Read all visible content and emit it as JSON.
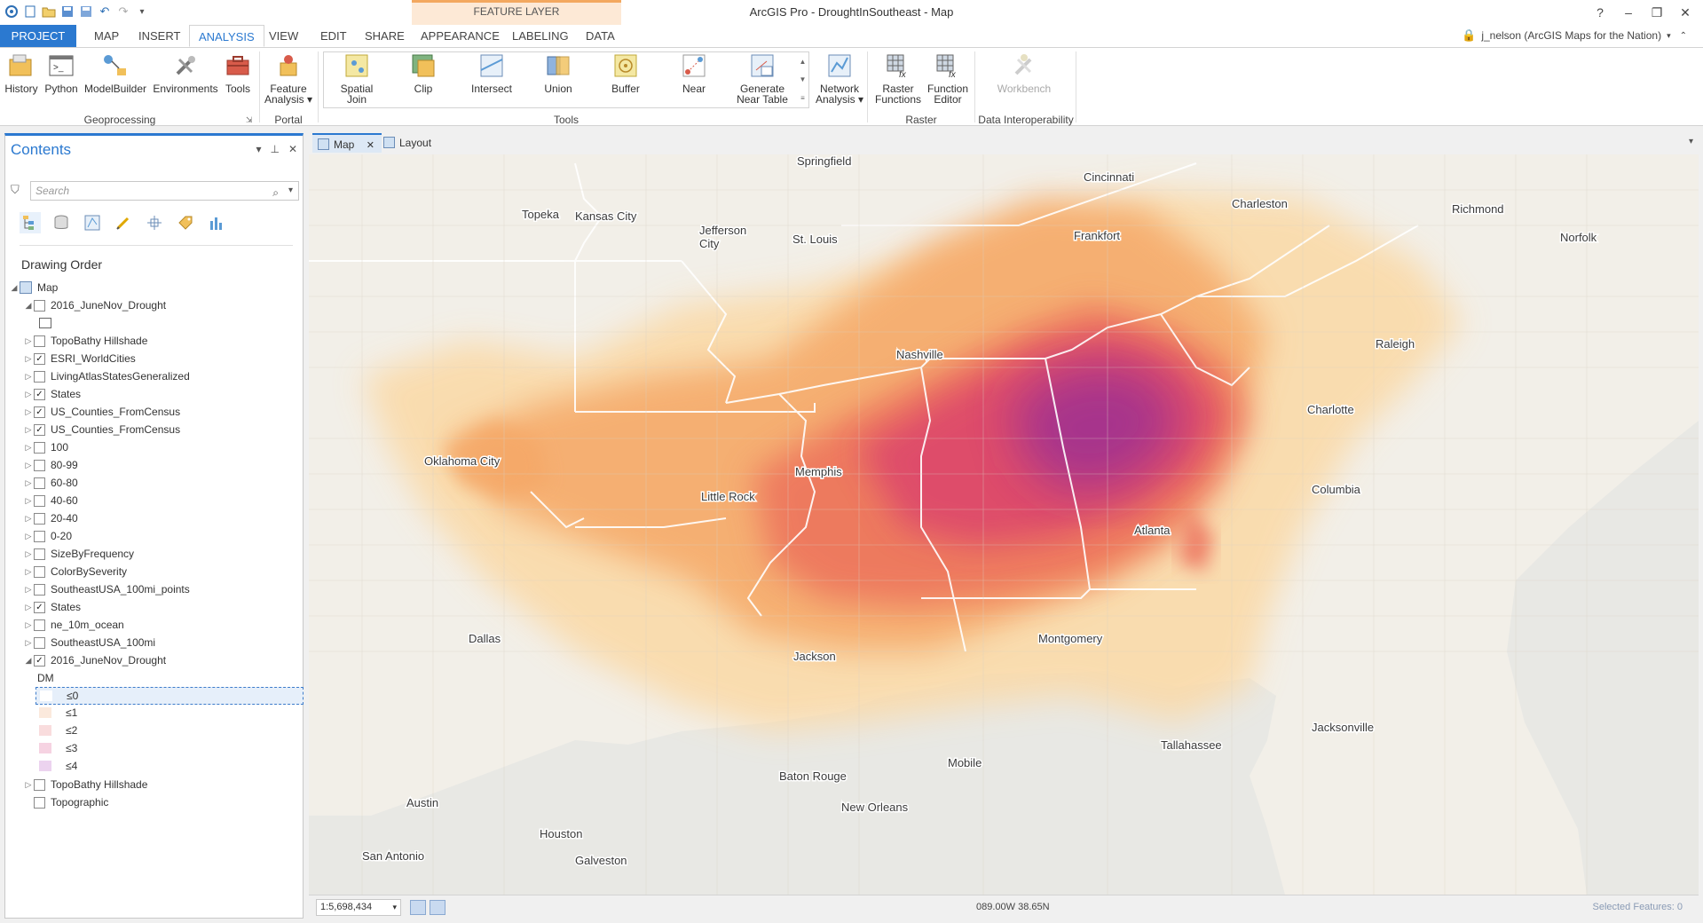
{
  "window": {
    "title": "ArcGIS Pro - DroughtInSoutheast - Map",
    "contextual_tab": "FEATURE LAYER",
    "help": "?",
    "minimize": "–",
    "restore": "❐",
    "close": "✕"
  },
  "ribbon_tabs": [
    "PROJECT",
    "MAP",
    "INSERT",
    "ANALYSIS",
    "VIEW",
    "EDIT",
    "SHARE",
    "APPEARANCE",
    "LABELING",
    "DATA"
  ],
  "user": "j_nelson (ArcGIS Maps for the Nation)",
  "ribbon": {
    "geoprocessing": {
      "label": "Geoprocessing",
      "buttons": [
        "History",
        "Python",
        "ModelBuilder",
        "Environments",
        "Tools"
      ]
    },
    "portal": {
      "label": "Portal",
      "feature_analysis": [
        "Feature",
        "Analysis"
      ]
    },
    "tools": {
      "label": "Tools",
      "spatial_join": [
        "Spatial",
        "Join"
      ],
      "clip": "Clip",
      "intersect": "Intersect",
      "union": "Union",
      "buffer": "Buffer",
      "near": "Near",
      "generate_near_table": [
        "Generate",
        "Near Table"
      ]
    },
    "network_analysis": [
      "Network",
      "Analysis"
    ],
    "raster": {
      "label": "Raster",
      "raster_functions": [
        "Raster",
        "Functions"
      ],
      "function_editor": [
        "Function",
        "Editor"
      ]
    },
    "data_interop": {
      "label": "Data Interoperability",
      "workbench": "Workbench"
    }
  },
  "contents": {
    "title": "Contents",
    "search_placeholder": "Search",
    "drawing_order": "Drawing Order",
    "map_name": "Map",
    "layers": [
      {
        "name": "2016_JuneNov_Drought",
        "checked": false,
        "expanded": true
      },
      {
        "name": "TopoBathy Hillshade",
        "checked": false
      },
      {
        "name": "ESRI_WorldCities",
        "checked": true
      },
      {
        "name": "LivingAtlasStatesGeneralized",
        "checked": false
      },
      {
        "name": "States",
        "checked": true
      },
      {
        "name": "US_Counties_FromCensus",
        "checked": true
      },
      {
        "name": "US_Counties_FromCensus",
        "checked": true
      },
      {
        "name": "100",
        "checked": false
      },
      {
        "name": "80-99",
        "checked": false
      },
      {
        "name": "60-80",
        "checked": false
      },
      {
        "name": "40-60",
        "checked": false
      },
      {
        "name": "20-40",
        "checked": false
      },
      {
        "name": "0-20",
        "checked": false
      },
      {
        "name": "SizeByFrequency",
        "checked": false
      },
      {
        "name": "ColorBySeverity",
        "checked": false
      },
      {
        "name": "SoutheastUSA_100mi_points",
        "checked": false
      },
      {
        "name": "States",
        "checked": true
      },
      {
        "name": "ne_10m_ocean",
        "checked": false
      },
      {
        "name": "SoutheastUSA_100mi",
        "checked": false
      },
      {
        "name": "2016_JuneNov_Drought",
        "checked": true,
        "expanded": true
      }
    ],
    "legend_field": "DM",
    "legend": [
      {
        "label": "≤0",
        "color": "#ffffff"
      },
      {
        "label": "≤1",
        "color": "#fbe9dc"
      },
      {
        "label": "≤2",
        "color": "#f9dcdd"
      },
      {
        "label": "≤3",
        "color": "#f6d3e2"
      },
      {
        "label": "≤4",
        "color": "#ecd3ef"
      }
    ],
    "after_layers": [
      {
        "name": "TopoBathy Hillshade",
        "checked": false
      },
      {
        "name": "Topographic",
        "checked": false
      }
    ]
  },
  "map_tabs": [
    "Map",
    "Layout"
  ],
  "map": {
    "cities": [
      "Springfield",
      "Cincinnati",
      "Charleston",
      "Richmond",
      "Norfolk",
      "Topeka",
      "Kansas City",
      "Jefferson",
      "City",
      "St. Louis",
      "Frankfort",
      "Raleigh",
      "Nashville",
      "Charlotte",
      "Oklahoma City",
      "Memphis",
      "Little Rock",
      "Columbia",
      "Atlanta",
      "Dallas",
      "Jackson",
      "Montgomery",
      "Mobile",
      "Tallahassee",
      "Jacksonville",
      "Baton Rouge",
      "New Orleans",
      "Austin",
      "Houston",
      "San Antonio",
      "Galveston"
    ],
    "colors": {
      "background": "#f2efe8",
      "ocean": "#e8e8e4",
      "light": "#fbd9a6",
      "orange": "#f5a868",
      "red": "#ec6d5a",
      "magenta": "#d93d6e",
      "purple": "#9a2f94"
    }
  },
  "status": {
    "scale": "1:5,698,434",
    "coordinates": "089.00W 38.65N",
    "selected_features": "Selected Features: 0"
  }
}
